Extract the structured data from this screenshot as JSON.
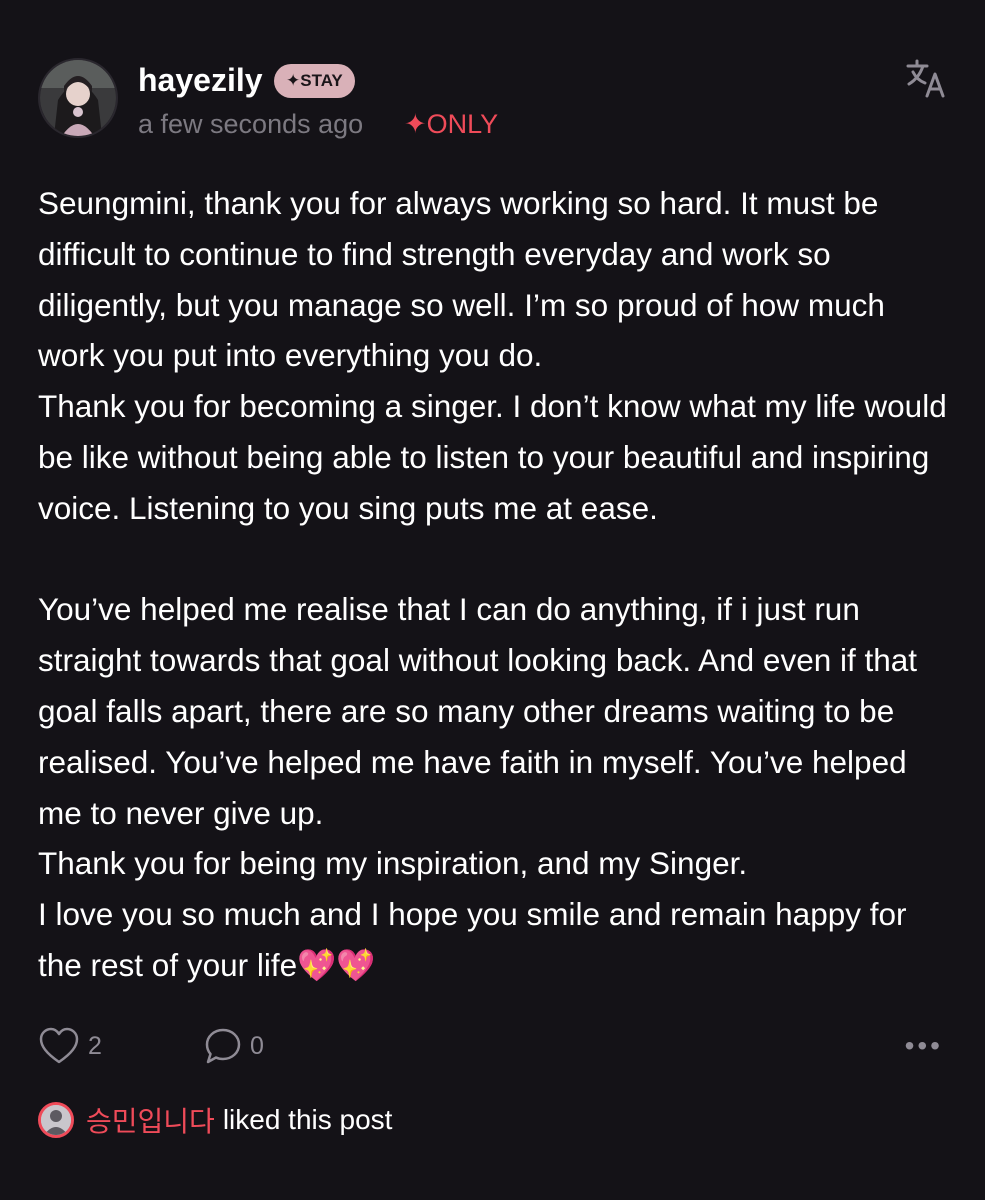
{
  "post": {
    "author": {
      "username": "hayezily",
      "badge": "✦STAY",
      "avatar_icon": "profile-photo"
    },
    "timestamp": "a few seconds ago",
    "visibility": "✦ONLY",
    "translate_icon": "translate-icon",
    "paragraphs": [
      "Seungmini, thank you for always working so hard. It must be difficult to continue to find strength everyday and work so diligently, but you manage so well. I’m so proud of how much work you put into everything you do.\nThank you for becoming a singer. I don’t know what my life would be like without being able to listen to your beautiful and inspiring voice. Listening to you sing puts me at ease.",
      "You’ve helped me realise that I can do anything, if i just run straight towards that goal without looking back. And even if that goal falls apart, there are so many other dreams waiting to be realised. You’ve helped me have faith in myself. You’ve helped me to never give up.\nThank you for being my inspiration, and my Singer.\nI love you so much and I hope you smile and remain happy for the rest of your life💖💖"
    ],
    "actions": {
      "like_count": "2",
      "comment_count": "0",
      "more_label": "•••"
    },
    "liked_by": {
      "name": "승민입니다",
      "suffix": "liked this post"
    }
  },
  "colors": {
    "background": "#141217",
    "accent_red": "#ef4b59",
    "badge_pink": "#d9b1b8",
    "muted": "#7c7981"
  }
}
